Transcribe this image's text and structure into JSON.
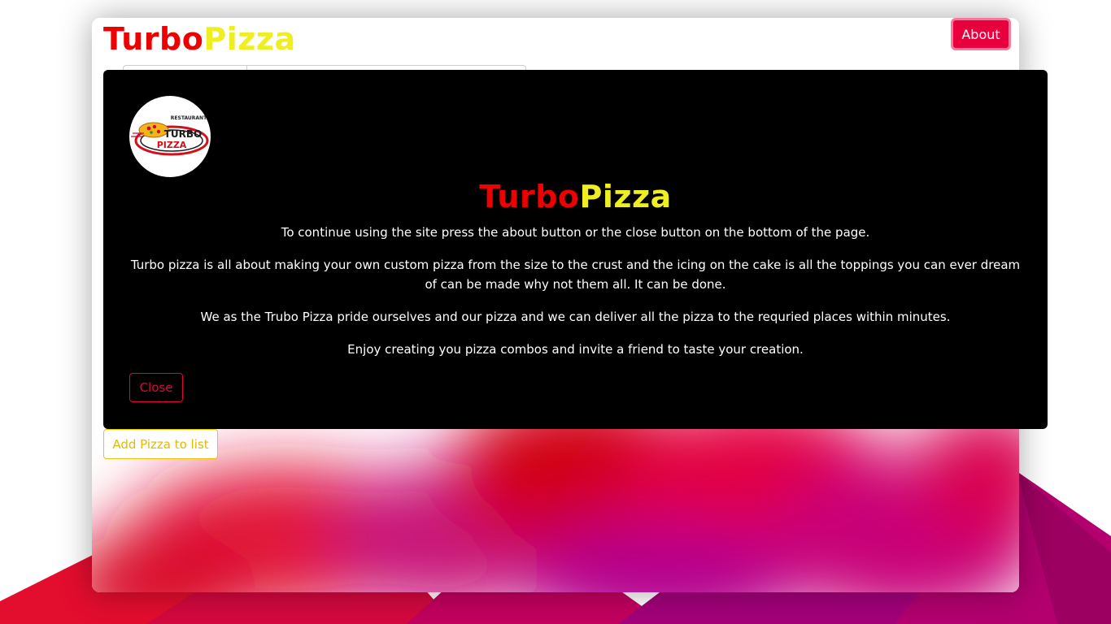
{
  "header": {
    "brand_turbo": "Turbo",
    "brand_pizza": "Pizza",
    "about_label": "About"
  },
  "main": {
    "add_pizza_label": "Add Pizza to list"
  },
  "modal": {
    "logo_text_top": "RESTAURANT",
    "logo_text_turbo": "TURBO",
    "logo_text_pizza": "PIZZA",
    "title_turbo": "Turbo",
    "title_pizza": "Pizza",
    "paragraphs": [
      "To continue using the site press the about button or the close button on the bottom of the page.",
      "Turbo pizza is all about making your own custom pizza from the size to the crust and the icing on the cake is all the toppings you can ever dream of can be made why not them all. It can be done.",
      "We as the Trubo Pizza pride ourselves and our pizza and we can deliver all the pizza to the requried places within minutes.",
      "Enjoy creating you pizza combos and invite a friend to taste your creation."
    ],
    "close_label": "Close"
  },
  "colors": {
    "brand_red": "#ee0000",
    "brand_yellow": "#eeee22",
    "accent_pink": "#e8003d",
    "add_button_yellow": "#f2c200",
    "modal_bg": "#000000"
  }
}
